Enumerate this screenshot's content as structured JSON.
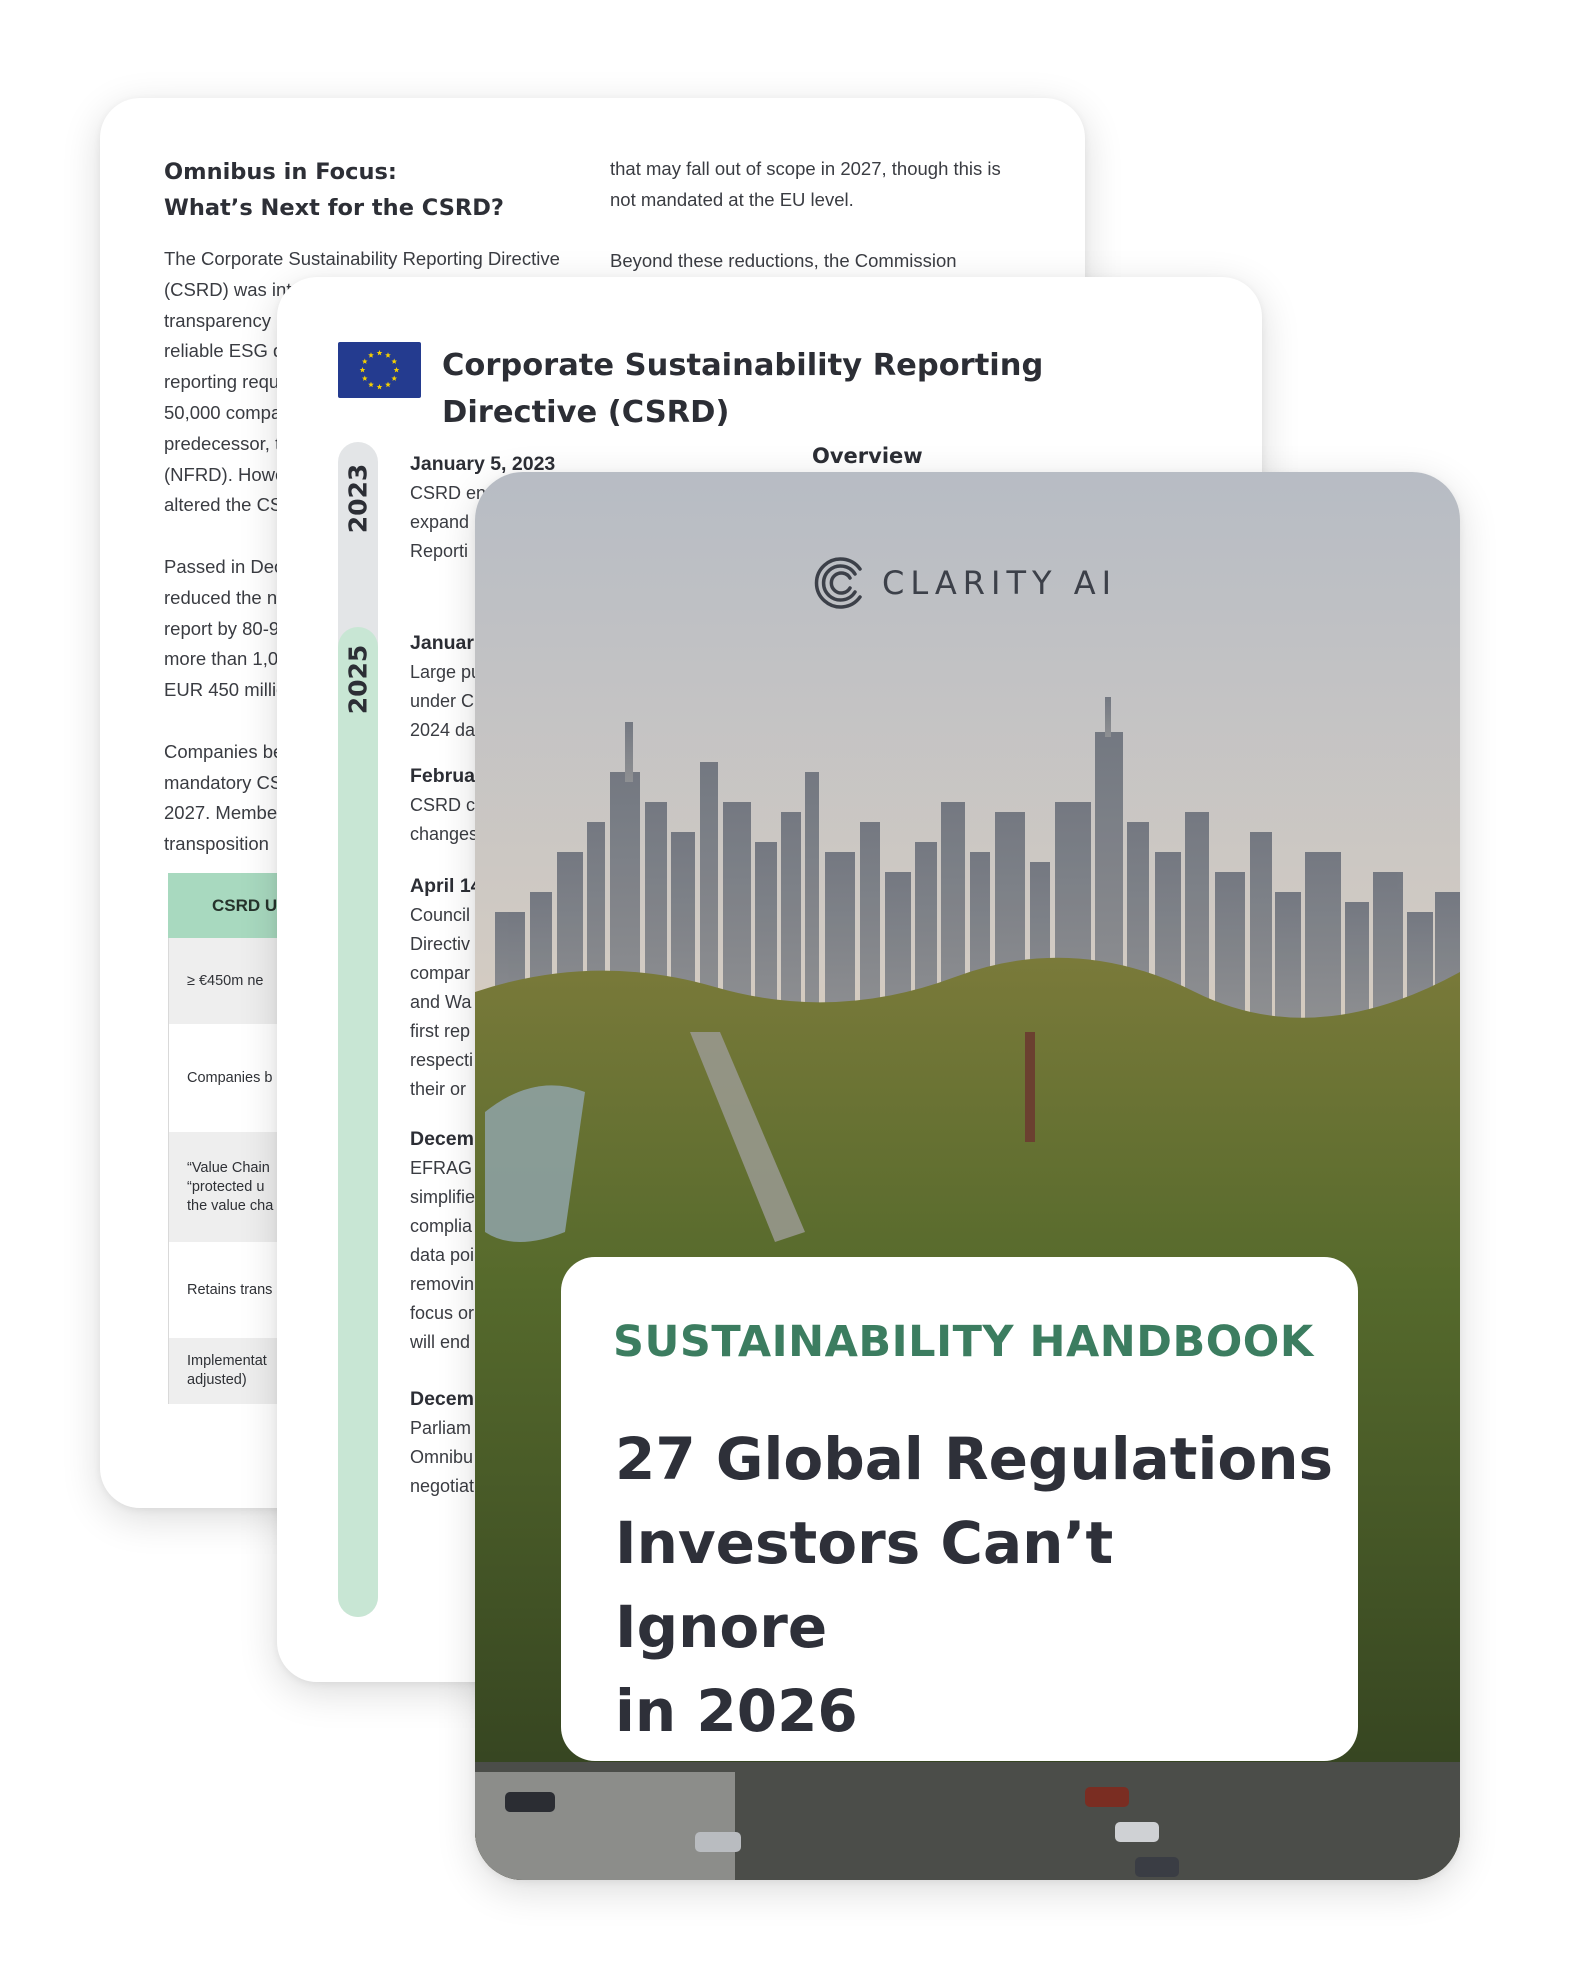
{
  "back_page": {
    "title_lines": [
      "Omnibus in Focus:",
      "What’s Next for the CSRD?"
    ],
    "col1_paragraphs": [
      [
        "The Corporate Sustainability Reporting Directive",
        "(CSRD) was intr",
        "transparency",
        "reliable ESG d",
        "reporting requ",
        "50,000 compa",
        "predecessor, t",
        "(NFRD). Howe",
        "altered the CS"
      ],
      [
        "Passed in Dec",
        "reduced the n",
        "report by 80-9",
        "more than 1,0",
        "EUR 450 millic"
      ],
      [
        "Companies be",
        "mandatory CS",
        "2027. Membe",
        "transposition"
      ]
    ],
    "col2_paragraphs": [
      [
        "that may fall out of scope in 2027, though this is",
        "not mandated at the EU level."
      ],
      [
        "Beyond these reductions, the Commission"
      ]
    ],
    "table": {
      "header": "CSRD U",
      "rows": [
        {
          "lines": [
            "≥ €450m ne"
          ]
        },
        {
          "lines": [
            "Companies b"
          ]
        },
        {
          "lines": [
            "“Value Chain",
            "“protected u",
            "the value cha"
          ]
        },
        {
          "lines": [
            "Retains trans"
          ]
        },
        {
          "lines": [
            "Implementat",
            "adjusted)"
          ]
        }
      ]
    }
  },
  "middle_page": {
    "title": "Corporate Sustainability Reporting Directive (CSRD)",
    "overview_label": "Overview",
    "years": [
      "2023",
      "2025"
    ],
    "entries": [
      {
        "date": "January 5, 2023",
        "lines": [
          "CSRD en",
          "expand",
          "Reporti"
        ]
      },
      {
        "date": "Januar",
        "lines": [
          "Large pu",
          "under C",
          "2024 da"
        ]
      },
      {
        "date": "Februa",
        "lines": [
          "CSRD cc",
          "changes"
        ]
      },
      {
        "date": "April 14",
        "lines": [
          "Council",
          "Directiv",
          "compar",
          "and Wa",
          "first rep",
          "respecti",
          "their or"
        ]
      },
      {
        "date": "Decemb",
        "lines": [
          "EFRAG p",
          "simplifie",
          "complia",
          "data poi",
          "removin",
          "focus or",
          "will end"
        ]
      },
      {
        "date": "Decemb",
        "lines": [
          "Parliam",
          "Omnibu",
          "negotiat"
        ]
      }
    ]
  },
  "cover": {
    "logo_text": "CLARITY AI",
    "kicker": "SUSTAINABILITY HANDBOOK",
    "title_lines": [
      "27 Global Regulations",
      "Investors Can’t Ignore",
      "in 2026"
    ]
  },
  "colors": {
    "accent_green": "#3c7d60",
    "table_header_green": "#a8d9bf",
    "timeline_green": "#c8e6d4",
    "eu_blue": "#243b8f",
    "eu_star": "#f5d000"
  }
}
